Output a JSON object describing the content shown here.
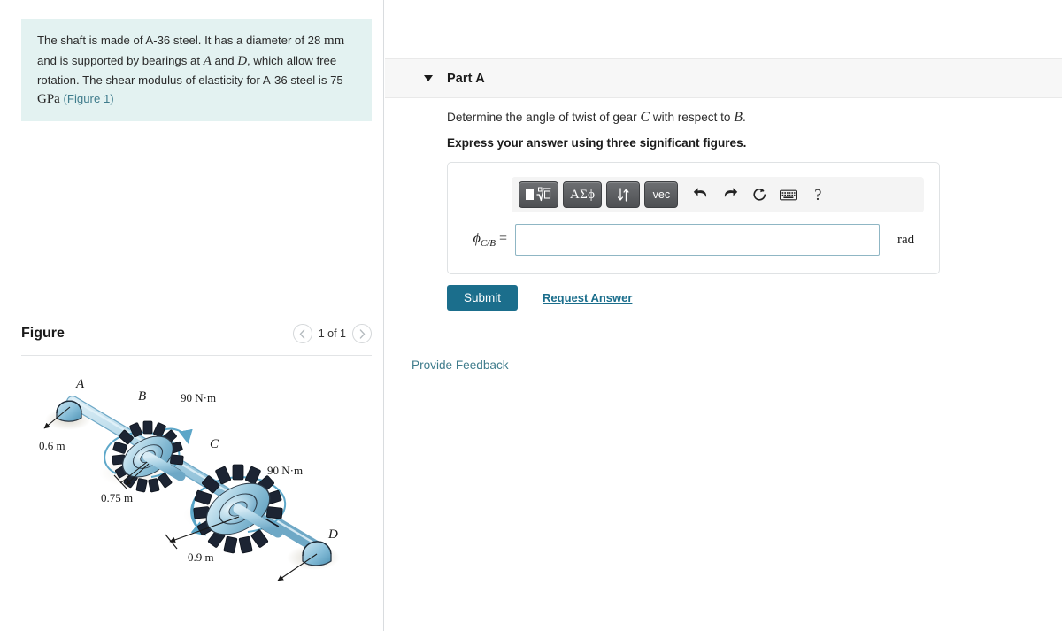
{
  "problem": {
    "line1_a": "The shaft is made of A-36 steel. It has a diameter of 28",
    "unit_mm": "mm",
    "line2_a": " and is supported by bearings at ",
    "pt_a": "A",
    "line2_b": " and ",
    "pt_d": "D",
    "line2_c": ", which",
    "line3": "allow free rotation. The shear modulus of elasticity for",
    "line4_a": "A-36 steel is 75 ",
    "unit_gpa": "GPa",
    "figure_link": "(Figure 1)"
  },
  "figure": {
    "title": "Figure",
    "prev_label": "‹",
    "next_label": "›",
    "counter": "1 of 1",
    "labels": {
      "a": "A",
      "b": "B",
      "c": "C",
      "d": "D",
      "torque_b": "90 N·m",
      "torque_c": "90 N·m",
      "dim_ab": "0.6 m",
      "dim_bc": "0.75 m",
      "dim_cd": "0.9 m"
    },
    "colors": {
      "shaft": "#a8cfe0",
      "gear_body": "#8cc3dc",
      "gear_teeth": "#1c2433",
      "support": "#7fb9d4",
      "arrow": "#4f9fc4"
    }
  },
  "part": {
    "header_label": "Part A",
    "question": "Determine the angle of twist of gear ",
    "question_gear": "C",
    "question_mid": " with respect to ",
    "question_ref": "B",
    "question_end": ".",
    "instruction": "Express your answer using three significant figures."
  },
  "answer": {
    "variable_phi": "ϕ",
    "variable_sub": "C/B",
    "equals": "=",
    "value": "",
    "placeholder": "",
    "unit": "rad",
    "toolbar": {
      "template_label": "√",
      "greek_label": "ΑΣϕ",
      "arrows_label": "↕",
      "vector_label": "vec",
      "undo_label": "undo-arrow",
      "redo_label": "redo-arrow",
      "reset_label": "reset-arrow",
      "keyboard_label": "keyboard",
      "help_label": "?"
    }
  },
  "actions": {
    "submit": "Submit",
    "request_answer": "Request Answer",
    "provide_feedback": "Provide Feedback"
  },
  "theme": {
    "problem_bg": "#e3f2f1",
    "accent": "#1b6e8c",
    "link": "#3f7c8c"
  }
}
